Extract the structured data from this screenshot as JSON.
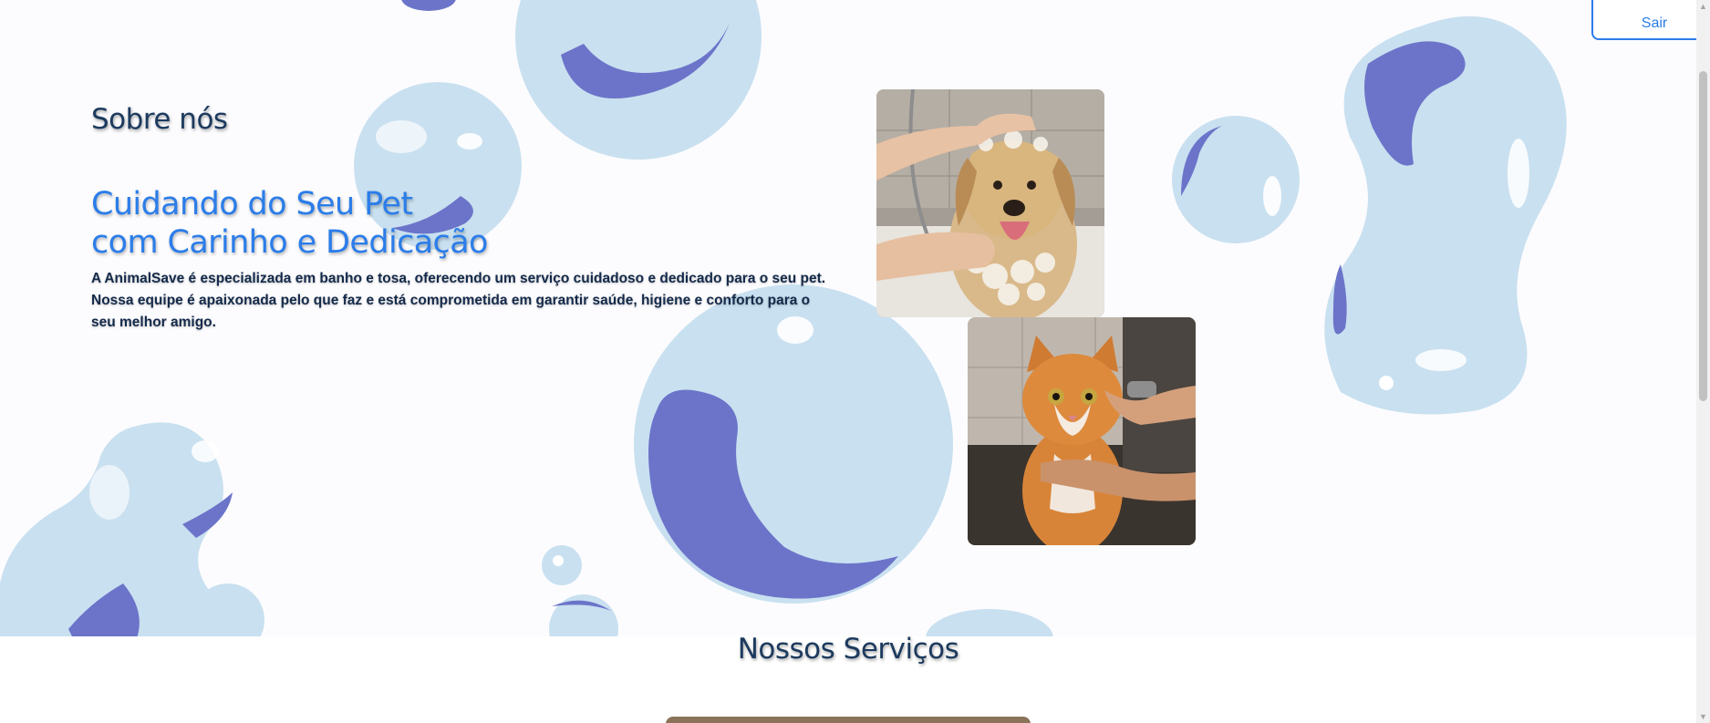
{
  "header": {
    "logout_label": "Sair"
  },
  "about": {
    "section_title": "Sobre nós",
    "headline_line1": "Cuidando do Seu Pet",
    "headline_line2": "com Carinho e Dedicação",
    "description": "A AnimalSave é especializada em banho e tosa, oferecendo um serviço cuidadoso e dedicado para o seu pet. Nossa equipe é apaixonada pelo que faz e está comprometida em garantir saúde, higiene e conforto para o seu melhor amigo."
  },
  "services": {
    "section_title": "Nossos Serviços"
  },
  "colors": {
    "accent": "#2b7de9",
    "heading_dark": "#1c3a5e",
    "bubble_light": "#c9e0f0",
    "bubble_dark": "#6b74c9"
  }
}
